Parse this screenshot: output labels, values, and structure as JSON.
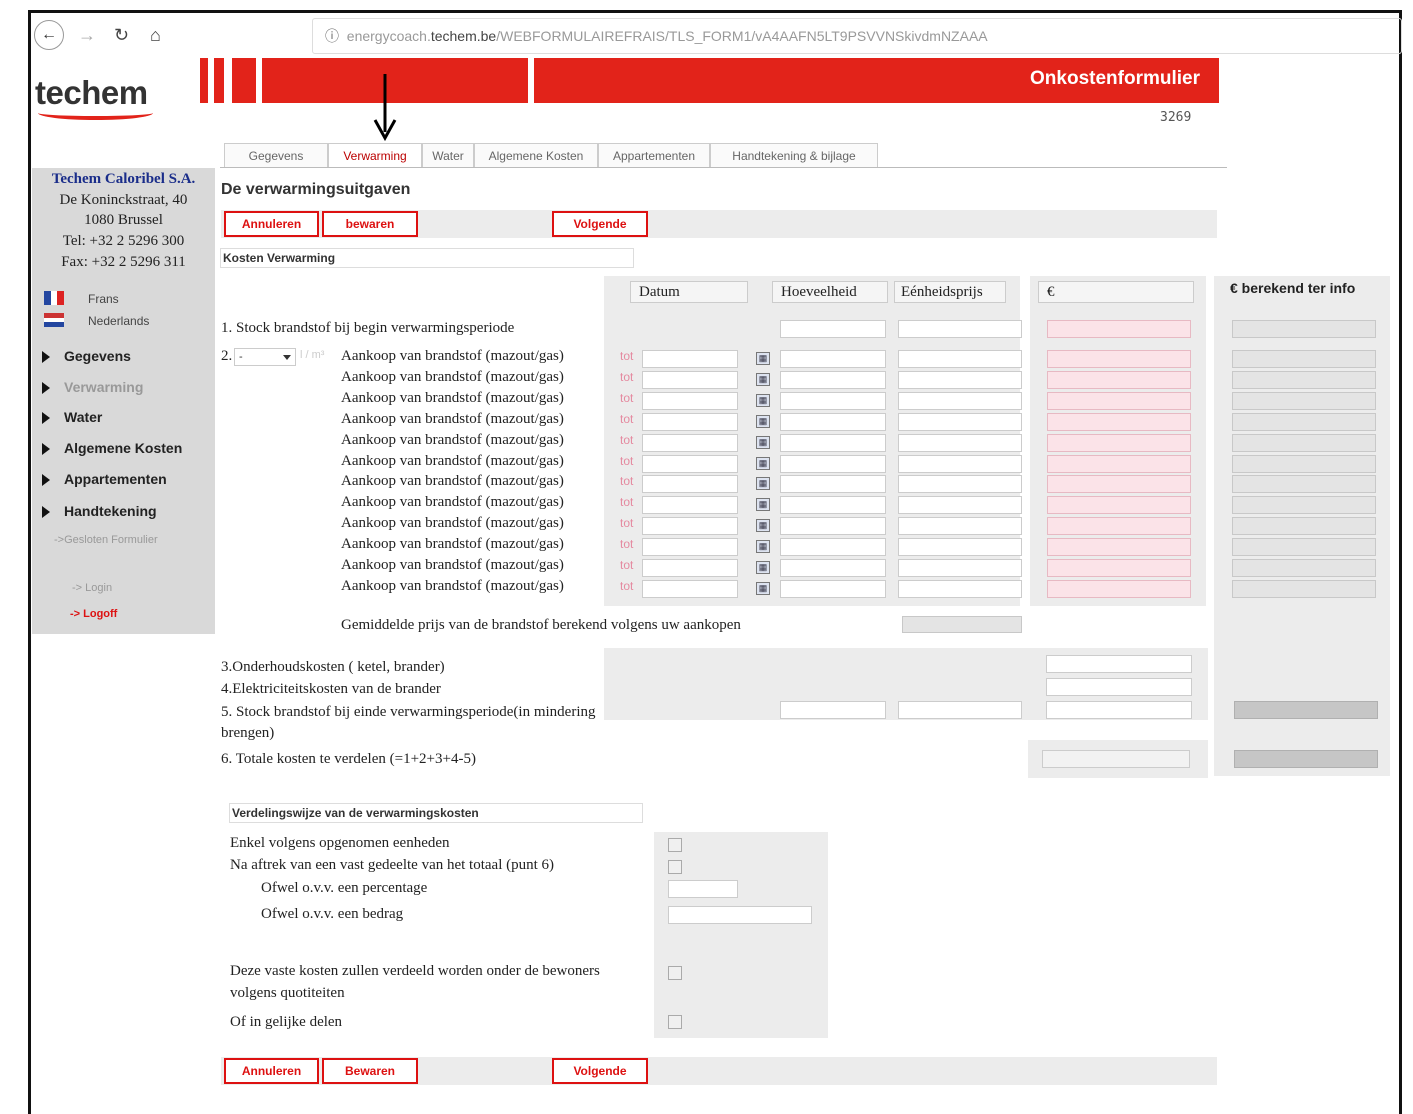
{
  "browser": {
    "url_prefix": "energycoach.",
    "url_host": "techem.be",
    "url_path": "/WEBFORMULAIREFRAIS/TLS_FORM1/vA4AAFN5LT9PSVVNSkivdmNZAAA"
  },
  "header": {
    "logo": "techem",
    "title": "Onkostenformulier",
    "form_number": "3269"
  },
  "tabs": [
    "Gegevens",
    "Verwarming",
    "Water",
    "Algemene Kosten",
    "Appartementen",
    "Handtekening & bijlage"
  ],
  "sidebar": {
    "company": "Techem Caloribel S.A.",
    "address1": "De Koninckstraat, 40",
    "address2": "1080 Brussel",
    "tel": "Tel: +32 2 5296 300",
    "fax": "Fax: +32 2 5296 311",
    "lang_fr": "Frans",
    "lang_nl": "Nederlands",
    "items": [
      "Gegevens",
      "Verwarming",
      "Water",
      "Algemene Kosten",
      "Appartementen",
      "Handtekening"
    ],
    "closed_form": "->Gesloten Formulier",
    "login": "-> Login",
    "logoff": "-> Logoff"
  },
  "main": {
    "title": "De verwarmingsuitgaven",
    "btn_cancel_top": "Annuleren",
    "btn_save_top": "bewaren",
    "btn_next_top": "Volgende",
    "section_costs": "Kosten Verwarming",
    "col_date": "Datum",
    "col_qty": "Hoeveelheid",
    "col_unit_price": "Eénheidsprijs",
    "col_eur": "€",
    "col_info": "€ berekend ter info",
    "line1": "1. Stock brandstof bij begin verwarmingsperiode",
    "line2_no": "2.",
    "line2_select": "-",
    "line2_unit": "l / m³",
    "purchase_label": "Aankoop van brandstof (mazout/gas)",
    "tot": "tot",
    "avg_price": "Gemiddelde prijs van de brandstof berekend volgens uw aankopen",
    "line3": "3.Onderhoudskosten ( ketel, brander)",
    "line4": "4.Elektriciteitskosten van de brander",
    "line5a": "5. Stock brandstof bij einde verwarmingsperiode(in mindering",
    "line5b": "brengen)",
    "line6": "6. Totale kosten te verdelen (=1+2+3+4-5)",
    "section_dist": "Verdelingswijze van de verwarmingskosten",
    "dist1": "Enkel volgens opgenomen eenheden",
    "dist2": "Na aftrek van een vast gedeelte  van het totaal (punt 6)",
    "dist2a": "Ofwel o.v.v. een percentage",
    "dist2b": "Ofwel o.v.v. een bedrag",
    "dist3a": "Deze vaste kosten zullen verdeeld worden onder de bewoners",
    "dist3b": "volgens quotiteiten",
    "dist4": "Of in gelijke delen",
    "btn_cancel_bottom": "Annuleren",
    "btn_save_bottom": "Bewaren",
    "btn_next_bottom": "Volgende"
  }
}
